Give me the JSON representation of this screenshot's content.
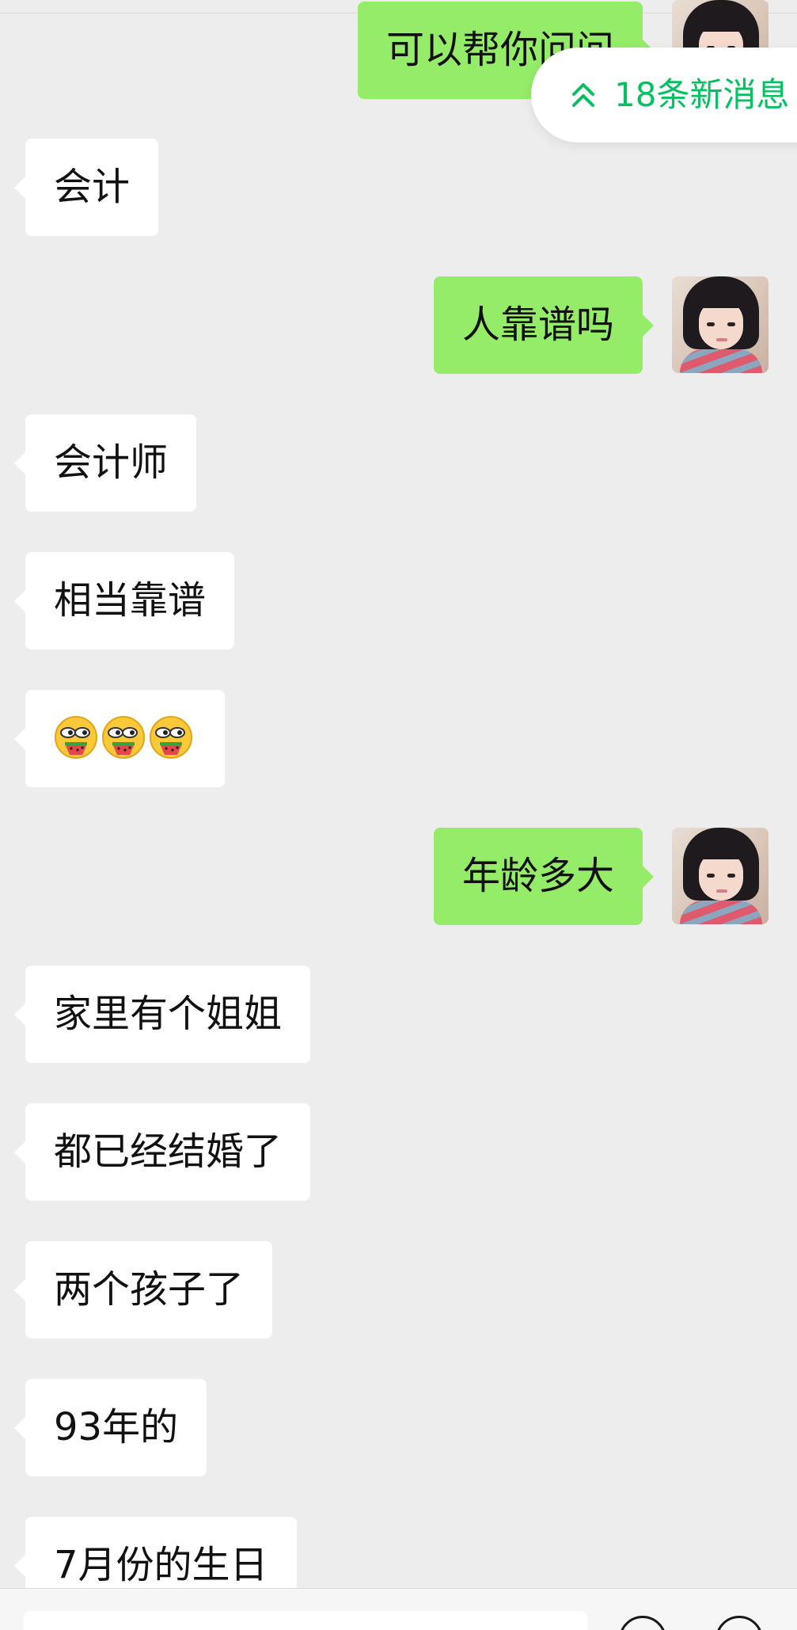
{
  "chat": {
    "messages": [
      {
        "side": "right",
        "text": "可以帮你问问"
      },
      {
        "side": "left",
        "text": "会计"
      },
      {
        "side": "right",
        "text": "人靠谱吗"
      },
      {
        "side": "left",
        "text": "会计师"
      },
      {
        "side": "left",
        "text": "相当靠谱"
      },
      {
        "side": "left",
        "text": "",
        "emoji": [
          "watermelon-eating-emoji",
          "watermelon-eating-emoji",
          "watermelon-eating-emoji"
        ]
      },
      {
        "side": "right",
        "text": "年龄多大"
      },
      {
        "side": "left",
        "text": "家里有个姐姐"
      },
      {
        "side": "left",
        "text": "都已经结婚了"
      },
      {
        "side": "left",
        "text": "两个孩子了"
      },
      {
        "side": "left",
        "text": "93年的"
      },
      {
        "side": "left",
        "text": "7月份的生日"
      }
    ]
  },
  "new_messages": {
    "label": "18条新消息",
    "icon": "double-chevron-up-icon",
    "color": "#07c160"
  },
  "colors": {
    "background": "#ededed",
    "sent_bubble": "#95ec69",
    "received_bubble": "#ffffff"
  },
  "input_bar": {
    "placeholder": ""
  }
}
